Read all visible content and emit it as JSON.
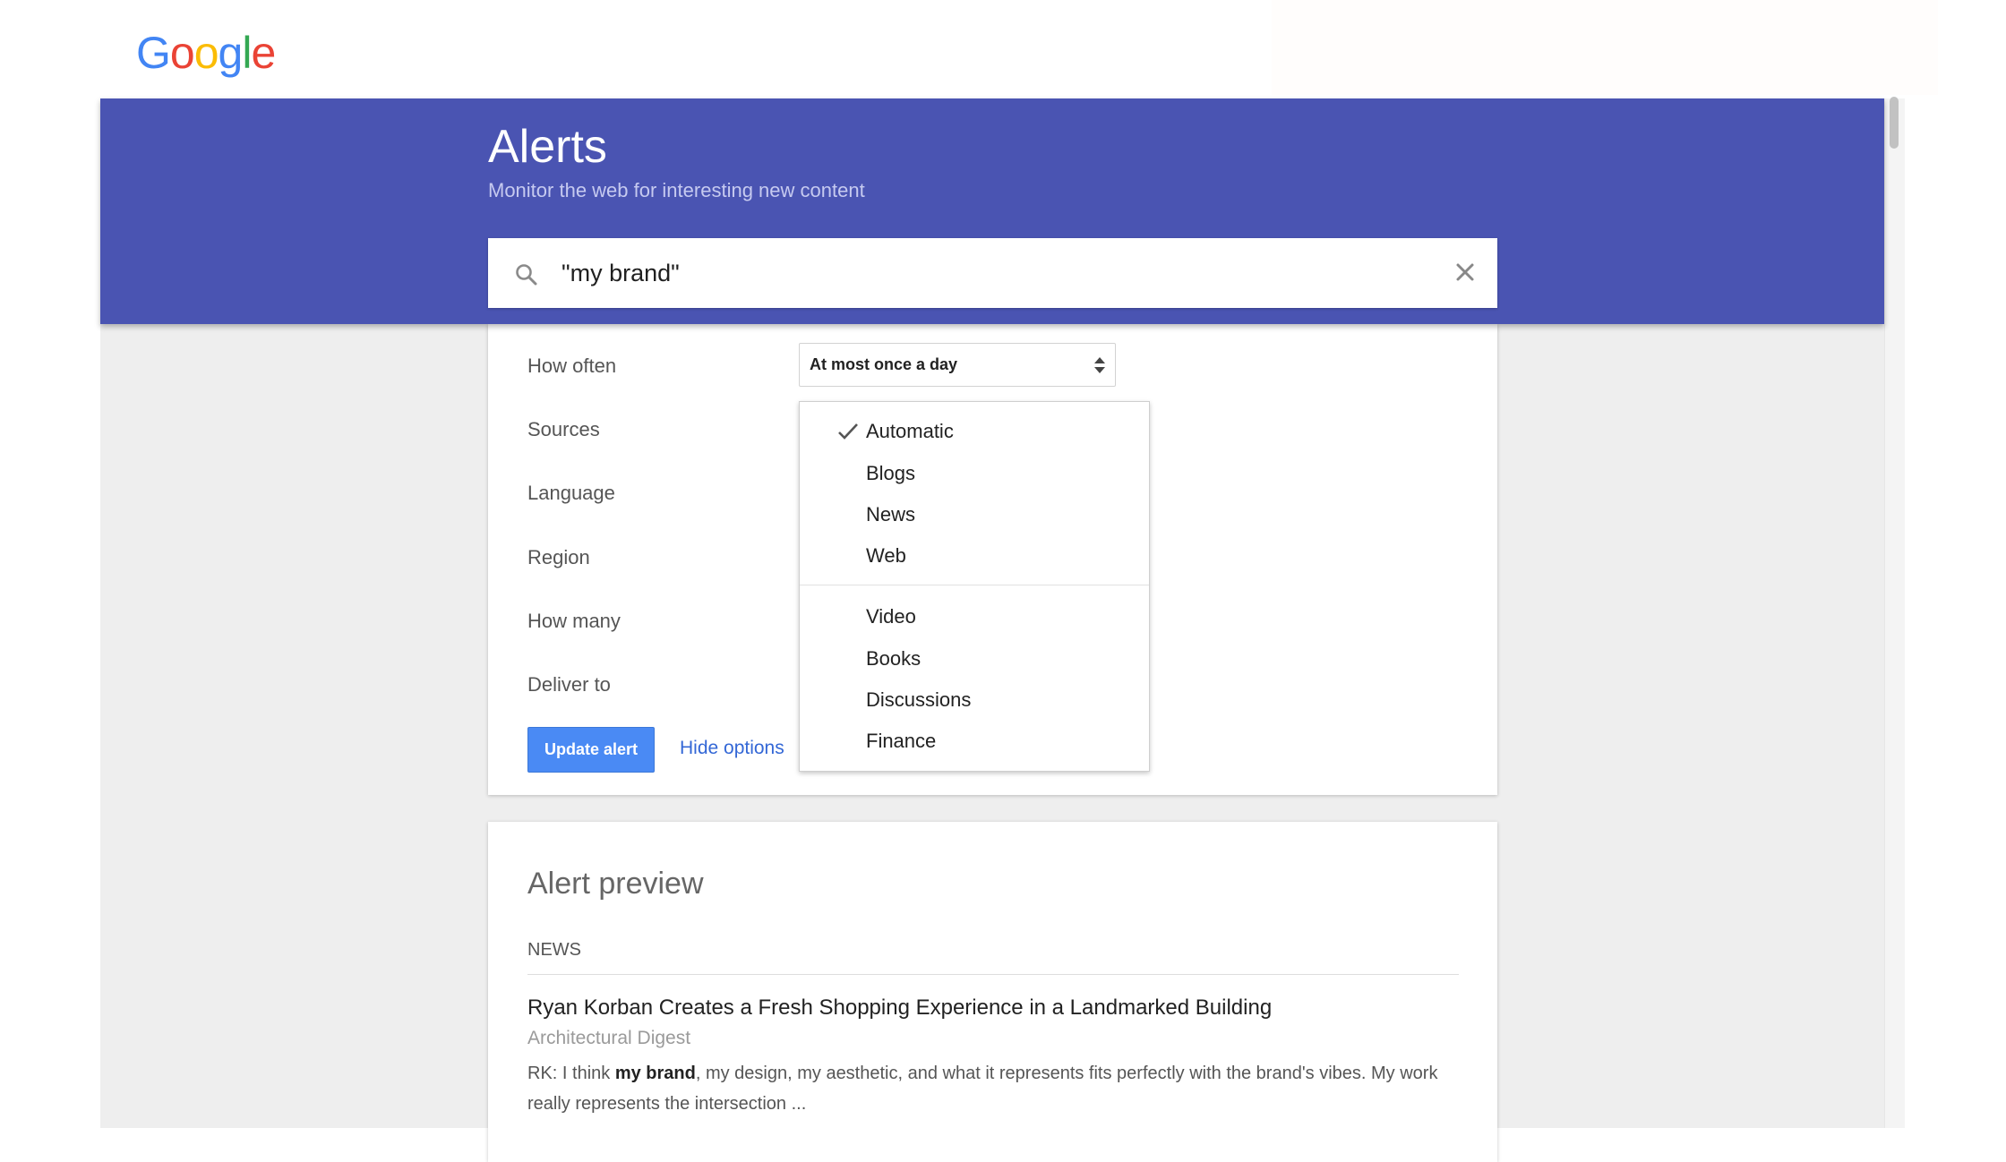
{
  "logo": {
    "letters": [
      "G",
      "o",
      "o",
      "g",
      "l",
      "e"
    ],
    "colors": [
      "#4285F4",
      "#EA4335",
      "#FBBC05",
      "#4285F4",
      "#34A853",
      "#EA4335"
    ]
  },
  "header": {
    "title": "Alerts",
    "subtitle": "Monitor the web for interesting new content",
    "background": "#4a54b2"
  },
  "search": {
    "value": "\"my brand\"",
    "icon": "search-icon",
    "clear_icon": "close-icon"
  },
  "options": {
    "labels": [
      "How often",
      "Sources",
      "Language",
      "Region",
      "How many",
      "Deliver to"
    ],
    "frequency": {
      "selected": "At most once a day"
    },
    "sources_menu": {
      "items": [
        "Automatic",
        "Blogs",
        "News",
        "Web",
        "Video",
        "Books",
        "Discussions",
        "Finance"
      ],
      "checked": "Automatic"
    },
    "update_button": "Update alert",
    "hide_options": "Hide options",
    "accent": "#4a8af4"
  },
  "preview": {
    "title": "Alert preview",
    "section": "NEWS",
    "article": {
      "title": "Ryan Korban Creates a Fresh Shopping Experience in a Landmarked Building",
      "source": "Architectural Digest",
      "snippet_before": "RK: I think ",
      "snippet_bold": "my brand",
      "snippet_after": ", my design, my aesthetic, and what it represents fits perfectly with the brand's vibes. My work really represents the intersection ..."
    }
  }
}
